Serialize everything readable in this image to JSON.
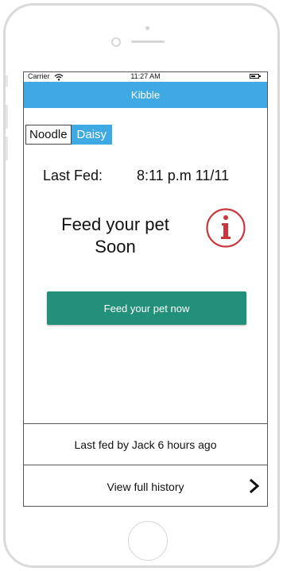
{
  "status_bar": {
    "carrier": "Carrier",
    "time": "11:27 AM",
    "wifi_icon": "wifi-icon",
    "battery_icon": "battery-icon"
  },
  "navbar": {
    "title": "Kibble"
  },
  "pet_tabs": [
    {
      "label": "Noodle",
      "selected": false
    },
    {
      "label": "Daisy",
      "selected": true
    }
  ],
  "last_fed": {
    "label": "Last Fed:",
    "value": "8:11 p.m 11/11"
  },
  "feed_message": {
    "line1": "Feed your pet",
    "line2": "Soon",
    "icon": "info-icon"
  },
  "feed_button": {
    "label": "Feed your pet now"
  },
  "last_fed_by": {
    "text": "Last fed by Jack 6 hours ago"
  },
  "history": {
    "label": "View full history",
    "icon": "chevron-right-icon"
  },
  "colors": {
    "accent_blue": "#3fa9e3",
    "button_green": "#23917a",
    "alert_red": "#c9363b"
  }
}
